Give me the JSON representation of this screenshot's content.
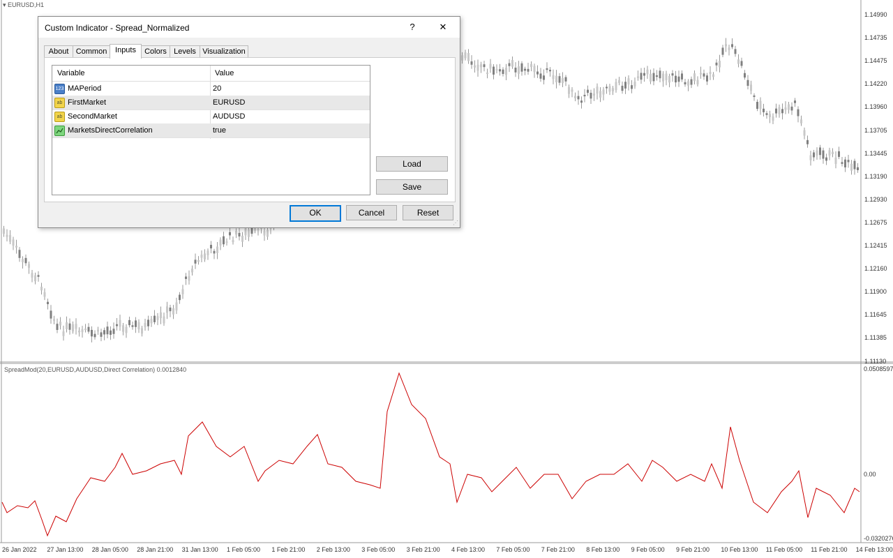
{
  "window": {
    "symbol_label": "EURUSD,H1"
  },
  "price_axis": [
    "1.14990",
    "1.14735",
    "1.14475",
    "1.14220",
    "1.13960",
    "1.13705",
    "1.13445",
    "1.13190",
    "1.12930",
    "1.12675",
    "1.12415",
    "1.12160",
    "1.11900",
    "1.11645",
    "1.11385",
    "1.11130"
  ],
  "indicator": {
    "label": "SpreadMod(20,EURUSD,AUDUSD,Direct Correlation) 0.0012840",
    "axis": [
      "0.0508597",
      "0.00",
      "-0.0320276"
    ],
    "color": "#cc0000"
  },
  "time_axis": [
    "26 Jan 2022",
    "27 Jan 13:00",
    "28 Jan 05:00",
    "28 Jan 21:00",
    "31 Jan 13:00",
    "1 Feb 05:00",
    "1 Feb 21:00",
    "2 Feb 13:00",
    "3 Feb 05:00",
    "3 Feb 21:00",
    "4 Feb 13:00",
    "7 Feb 05:00",
    "7 Feb 21:00",
    "8 Feb 13:00",
    "9 Feb 05:00",
    "9 Feb 21:00",
    "10 Feb 13:00",
    "11 Feb 05:00",
    "11 Feb 21:00",
    "14 Feb 13:00"
  ],
  "dialog": {
    "title": "Custom Indicator - Spread_Normalized",
    "help_label": "?",
    "close_label": "✕",
    "tabs": [
      "About",
      "Common",
      "Inputs",
      "Colors",
      "Levels",
      "Visualization"
    ],
    "active_tab": "Inputs",
    "columns": {
      "variable": "Variable",
      "value": "Value"
    },
    "rows": [
      {
        "icon": "123",
        "name": "MAPeriod",
        "value": "20"
      },
      {
        "icon": "ab",
        "name": "FirstMarket",
        "value": "EURUSD"
      },
      {
        "icon": "ab",
        "name": "SecondMarket",
        "value": "AUDUSD"
      },
      {
        "icon": "bool-icon",
        "name": "MarketsDirectCorrelation",
        "value": "true"
      }
    ],
    "buttons": {
      "load": "Load",
      "save": "Save",
      "ok": "OK",
      "cancel": "Cancel",
      "reset": "Reset"
    }
  },
  "colors": {
    "dialog_accent": "#0078d7",
    "candle": "#808080"
  }
}
